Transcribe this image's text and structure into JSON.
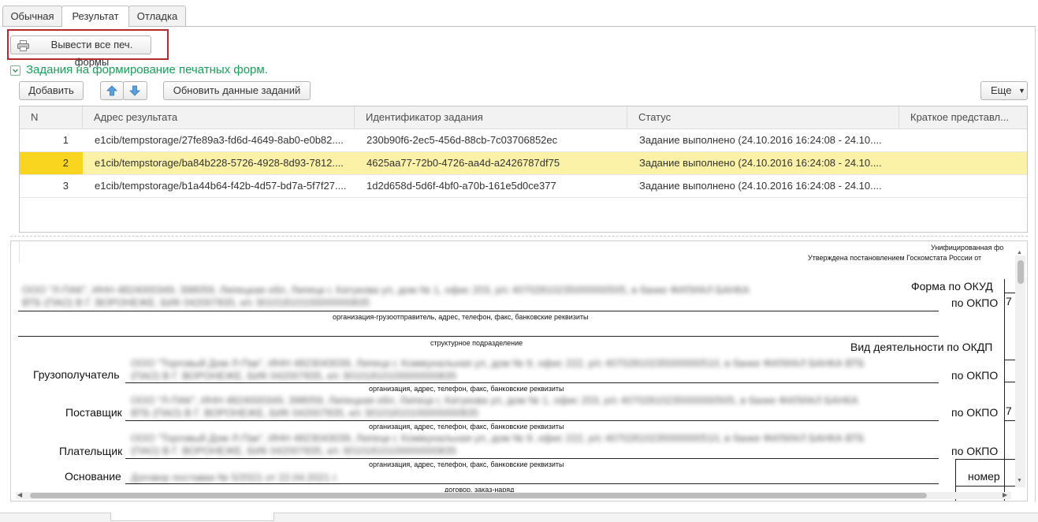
{
  "tabs": [
    {
      "label": "Обычная"
    },
    {
      "label": "Результат"
    },
    {
      "label": "Отладка"
    }
  ],
  "toolbar": {
    "print_all_label": "Вывести все печ. формы"
  },
  "group": {
    "title": "Задания на формирование печатных форм."
  },
  "actions": {
    "add_label": "Добавить",
    "refresh_label": "Обновить данные заданий",
    "more_label": "Еще"
  },
  "table": {
    "columns": [
      "N",
      "Адрес результата",
      "Идентификатор задания",
      "Статус",
      "Краткое представл..."
    ],
    "rows": [
      {
        "n": "1",
        "address": "e1cib/tempstorage/27fe89a3-fd6d-4649-8ab0-e0b82....",
        "id": "230b90f6-2ec5-456d-88cb-7c03706852ec",
        "status": "Задание выполнено (24.10.2016 16:24:08 - 24.10....",
        "short": ""
      },
      {
        "n": "2",
        "address": "e1cib/tempstorage/ba84b228-5726-4928-8d93-7812....",
        "id": "4625aa77-72b0-4726-aa4d-a2426787df75",
        "status": "Задание выполнено (24.10.2016 16:24:08 - 24.10....",
        "short": ""
      },
      {
        "n": "3",
        "address": "e1cib/tempstorage/b1a44b64-f42b-4d57-bd7a-5f7f27....",
        "id": "1d2d658d-5d6f-4bf0-a70b-161e5d0ce377",
        "status": "Задание выполнено (24.10.2016 16:24:08 - 24.10....",
        "short": ""
      }
    ]
  },
  "report": {
    "header1": "Унифицированная фо",
    "header2": "Утверждена постановлением Госкомстата России от",
    "forma_okud": "Форма по ОКУД",
    "po_okpo": "по ОКПО",
    "vid_deyat": "Вид деятельности по ОКДП",
    "caption_org_full": "организация-грузоотправитель, адрес, телефон, факс, банковские реквизиты",
    "caption_struct": "структурное подразделение",
    "caption_org": "организация, адрес, телефон, факс, банковские реквизиты",
    "caption_contract": "договор, заказ-наряд",
    "consignee": "Грузополучатель",
    "supplier": "Поставщик",
    "payer": "Плательщик",
    "basis": "Основание",
    "nomer": "номер",
    "shipper_line1": "ООО \"Л-ПАК\", ИНН 4824000349, 398059, Липецкая обл, Липецк г, Катукова ул, дом № 1, офис 203, р/с 40702810235000000505, в банке ФИЛИАЛ БАНКА",
    "shipper_line2": "ВТБ (ПАО) В Г. ВОРОНЕЖЕ, БИК 042007835, к/с 30101810100000000835",
    "consignee_line1": "ООО \"Торговый Дом Л-Пак\", ИНН 4823043039, Липецк г, Коммунальная ул, дом № 9, офис 222, р/с 40702810235000000510, в банке ФИЛИАЛ БАНКА ВТБ",
    "consignee_line2": "(ПАО) В Г. ВОРОНЕЖЕ, БИК 042007835, к/с 30101810100000000835",
    "supplier_line1": "ООО \"Л-ПАК\", ИНН 4824000349, 398059, Липецкая обл, Липецк г, Катукова ул, дом № 1, офис 203, р/с 40702810235000000505, в банке ФИЛИАЛ БАНКА",
    "supplier_line2": "ВТБ (ПАО) В Г. ВОРОНЕЖЕ, БИК 042007835, к/с 30101810100000000835",
    "payer_line1": "ООО \"Торговый Дом Л-Пак\", ИНН 4823043039, Липецк г, Коммунальная ул, дом № 9, офис 222, р/с 40702810235000000510, в банке ФИЛИАЛ БАНКА ВТБ",
    "payer_line2": "(ПАО) В Г. ВОРОНЕЖЕ, БИК 042007835, к/с 30101810100000000835",
    "basis_value": "Договор поставки № 5/2021 от 22.04.2021 г."
  },
  "colors": {
    "selected_row": "#fbf1a7",
    "row_marker": "#f9d520",
    "group_title": "#18a05a",
    "highlight_outline": "#b52a2a"
  }
}
